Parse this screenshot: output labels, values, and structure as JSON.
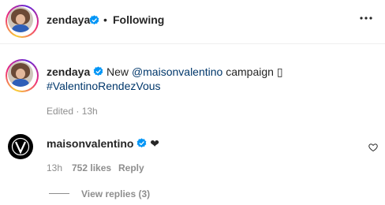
{
  "header": {
    "username": "zendaya",
    "separator": "•",
    "follow_status": "Following",
    "more_icon": "more-horizontal-icon"
  },
  "caption": {
    "username": "zendaya",
    "text_prefix": "New",
    "mention": "@maisonvalentino",
    "text_suffix": "campaign",
    "emoji_placeholder": "▯",
    "hashtag": "#ValentinoRendezVous",
    "edited": "Edited · 13h"
  },
  "comment": {
    "username": "maisonvalentino",
    "text": "❤",
    "time": "13h",
    "likes": "752 likes",
    "reply": "Reply",
    "view_replies": "View replies (3)"
  },
  "colors": {
    "link": "#00376b",
    "verified": "#0095f6",
    "secondary_text": "#8e8e8e"
  }
}
